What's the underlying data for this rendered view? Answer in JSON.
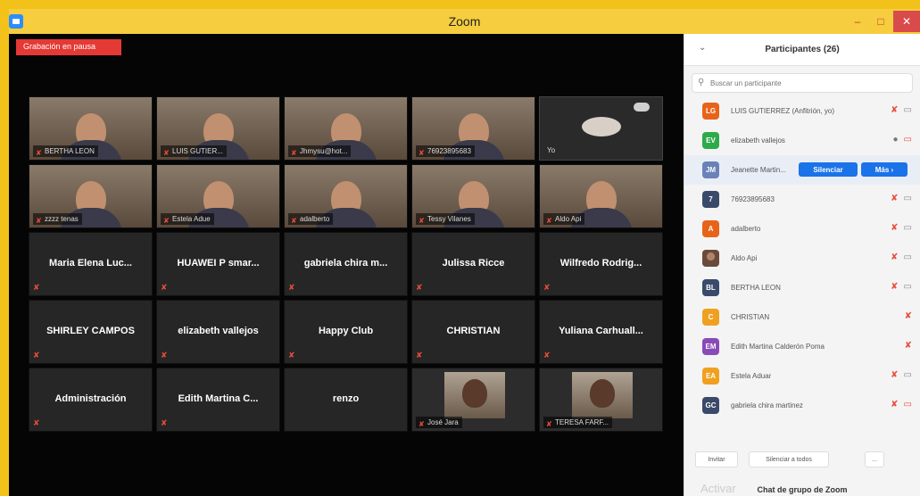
{
  "window": {
    "title": "Zoom"
  },
  "recording": {
    "label": "Grabación en pausa"
  },
  "video_tiles": [
    {
      "name": "BERTHA LEON"
    },
    {
      "name": "LUIS GUTIER..."
    },
    {
      "name": "Jhmysu@hot..."
    },
    {
      "name": "76923895683"
    },
    {
      "name": "Yo"
    },
    {
      "name": "zzzz tenas"
    },
    {
      "name": "Estela Adue"
    },
    {
      "name": "adalberto"
    },
    {
      "name": "Tessy Vilanes"
    },
    {
      "name": "Aldo Api"
    }
  ],
  "name_tiles": [
    "Maria Elena Luc...",
    "HUAWEI P smar...",
    "gabriela chira m...",
    "Julissa Ricce",
    "Wilfredo  Rodrig...",
    "SHIRLEY CAMPOS",
    "elizabeth vallejos",
    "Happy Club",
    "CHRISTIAN",
    "Yuliana  Carhuall...",
    "Administración",
    "Edith  Martina  C...",
    "renzo"
  ],
  "photo_tiles": [
    {
      "name": "José Jara"
    },
    {
      "name": "TERESA FARF..."
    }
  ],
  "panel": {
    "title": "Participantes (26)",
    "search_placeholder": "Buscar un participante",
    "mute_button": "Silenciar",
    "more_button": "Más ›",
    "participants": [
      {
        "initials": "LG",
        "color": "#e8631a",
        "name": "LUIS GUTIERREZ (Anfitrión, yo)"
      },
      {
        "initials": "EV",
        "color": "#2eaa4a",
        "name": "elizabeth vallejos"
      },
      {
        "initials": "JM",
        "color": "#6a82b8",
        "name": "Jeanette Martin..."
      },
      {
        "initials": "7",
        "color": "#3a4a6a",
        "name": "76923895683"
      },
      {
        "initials": "A",
        "color": "#e8631a",
        "name": "adalberto"
      },
      {
        "initials": "",
        "color": "",
        "name": "Aldo Api"
      },
      {
        "initials": "BL",
        "color": "#3a4a6a",
        "name": "BERTHA LEON"
      },
      {
        "initials": "C",
        "color": "#f0a020",
        "name": "CHRISTIAN"
      },
      {
        "initials": "EM",
        "color": "#8a4ab8",
        "name": "Edith Martina Calderón Poma"
      },
      {
        "initials": "EA",
        "color": "#f0a020",
        "name": "Estela Aduar"
      },
      {
        "initials": "GC",
        "color": "#3a4a6a",
        "name": "gabriela chira martinez"
      }
    ],
    "invite_button": "Invitar",
    "mute_all_button": "Silenciar a todos",
    "more_options": "...",
    "chat_title": "Chat de grupo de Zoom",
    "watermark": "Activar"
  }
}
